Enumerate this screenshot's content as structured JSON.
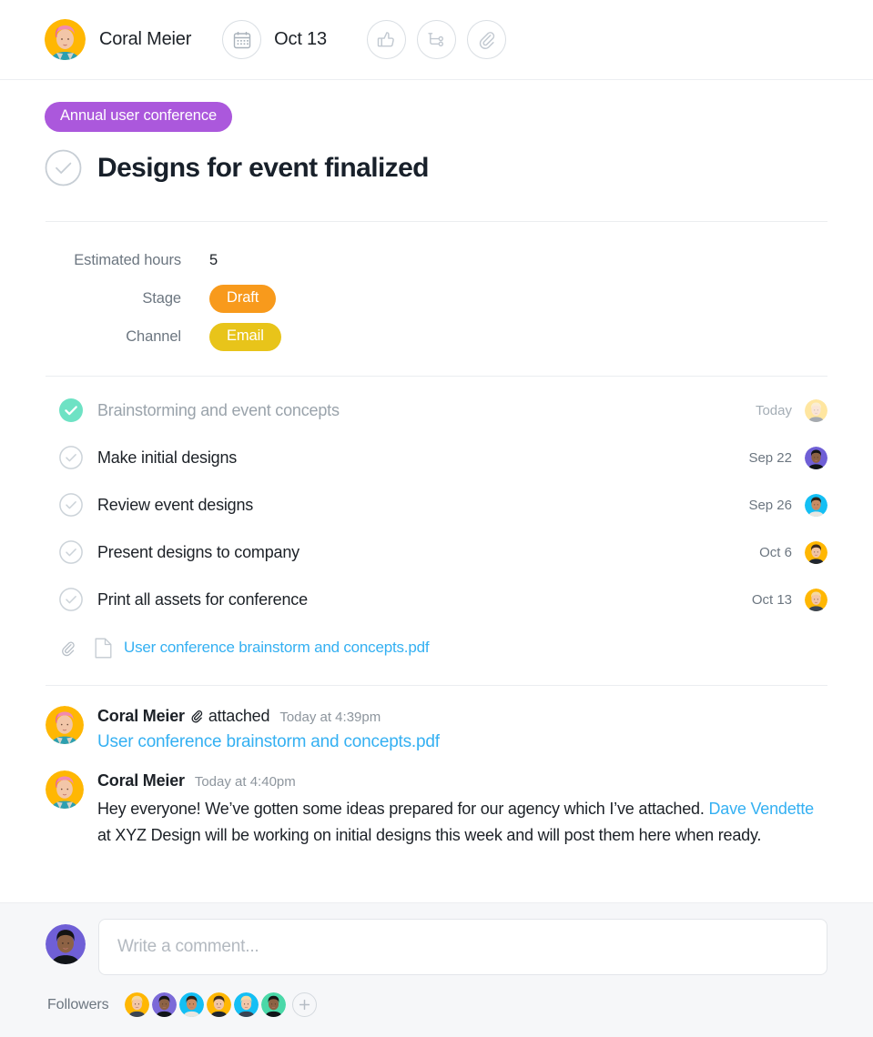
{
  "header": {
    "user_name": "Coral Meier",
    "due_date": "Oct 13",
    "calendar_icon": "calendar-icon",
    "actions": [
      {
        "name": "like-button",
        "icon": "thumbs-up-icon"
      },
      {
        "name": "subtask-button",
        "icon": "subtask-branch-icon"
      },
      {
        "name": "attach-button",
        "icon": "paperclip-icon"
      }
    ]
  },
  "task": {
    "project_tag": "Annual user conference",
    "project_tag_color": "#ab58dc",
    "title": "Designs for event finalized",
    "complete_icon": "check-circle-icon"
  },
  "fields": [
    {
      "label": "Estimated hours",
      "value": "5",
      "type": "text"
    },
    {
      "label": "Stage",
      "value": "Draft",
      "type": "pill",
      "color": "#f89a1c"
    },
    {
      "label": "Channel",
      "value": "Email",
      "type": "pill",
      "color": "#e8c41a"
    }
  ],
  "subtasks": [
    {
      "title": "Brainstorming and event concepts",
      "date": "Today",
      "done": true,
      "avatar_color": "#ffc92e"
    },
    {
      "title": "Make initial designs",
      "date": "Sep 22",
      "done": false,
      "avatar_color": "#6f5fd6"
    },
    {
      "title": "Review event designs",
      "date": "Sep 26",
      "done": false,
      "avatar_color": "#14bff4"
    },
    {
      "title": "Present designs to company",
      "date": "Oct 6",
      "done": false,
      "avatar_color": "#ffb703"
    },
    {
      "title": "Print all assets for conference",
      "date": "Oct 13",
      "done": false,
      "avatar_color": "#ffb703"
    }
  ],
  "attachment": {
    "clip_icon": "paperclip-icon",
    "file_icon": "file-icon",
    "file_name": "User conference brainstorm and concepts.pdf",
    "link_color": "#34b0f2"
  },
  "feed": [
    {
      "author": "Coral Meier",
      "verb": "attached",
      "time": "Today at 4:39pm",
      "clip_icon": "paperclip-icon",
      "link": "User conference brainstorm and concepts.pdf",
      "avatar_color": "#ffb703"
    },
    {
      "author": "Coral Meier",
      "time": "Today at 4:40pm",
      "avatar_color": "#ffb703",
      "text_before": "Hey everyone! We’ve gotten some ideas prepared for our agency which I’ve attached. ",
      "mention": "Dave Vendette",
      "text_after": " at XYZ Design will be working on initial designs this week and will post them here when ready."
    }
  ],
  "composer": {
    "placeholder": "Write a comment...",
    "avatar_color": "#6f5fd6"
  },
  "followers": {
    "label": "Followers",
    "avatars": [
      {
        "color": "#ffb703"
      },
      {
        "color": "#7b6ad8"
      },
      {
        "color": "#14bff4"
      },
      {
        "color": "#ffb703"
      },
      {
        "color": "#14bff4"
      },
      {
        "color": "#4ad8a8"
      }
    ],
    "add_label": "+",
    "add_icon": "plus-icon"
  }
}
